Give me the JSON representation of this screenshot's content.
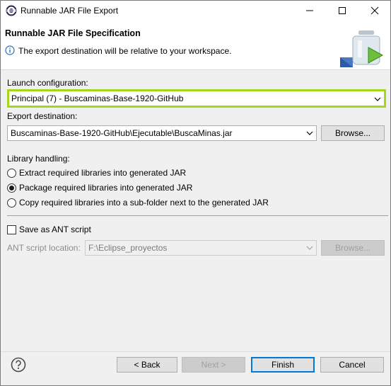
{
  "window": {
    "title": "Runnable JAR File Export",
    "icon": "eclipse-icon",
    "controls": [
      "minimize-icon",
      "maximize-icon",
      "close-icon"
    ]
  },
  "header": {
    "title": "Runnable JAR File Specification",
    "message": "The export destination will be relative to your workspace.",
    "message_icon": "info-icon",
    "banner_icon": "jar-export-icon"
  },
  "launch": {
    "label": "Launch configuration:",
    "value": "Principal (7) - Buscaminas-Base-1920-GitHub"
  },
  "export": {
    "label": "Export destination:",
    "value": "Buscaminas-Base-1920-GitHub\\Ejecutable\\BuscaMinas.jar",
    "browse_label": "Browse..."
  },
  "library": {
    "label": "Library handling:",
    "options": [
      {
        "label": "Extract required libraries into generated JAR",
        "checked": false
      },
      {
        "label": "Package required libraries into generated JAR",
        "checked": true
      },
      {
        "label": "Copy required libraries into a sub-folder next to the generated JAR",
        "checked": false
      }
    ]
  },
  "ant": {
    "save_label": "Save as ANT script",
    "save_checked": false,
    "location_label": "ANT script location:",
    "location_value": "F:\\Eclipse_proyectos",
    "browse_label": "Browse..."
  },
  "footer": {
    "help_icon": "help-icon",
    "back_label": "< Back",
    "next_label": "Next >",
    "finish_label": "Finish",
    "cancel_label": "Cancel"
  },
  "colors": {
    "highlight": "#a6d61a",
    "default_button_border": "#0078d7",
    "window_bg": "#f0f0f0"
  }
}
